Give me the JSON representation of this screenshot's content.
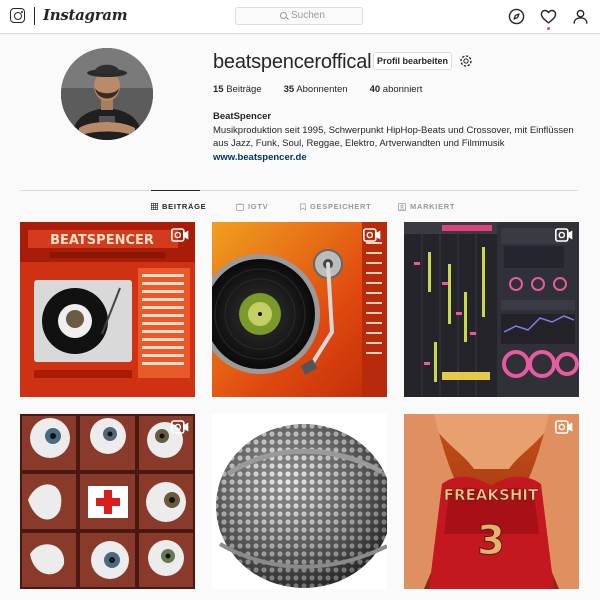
{
  "header": {
    "logo_text": "Instagram",
    "search_placeholder": "Suchen",
    "icons": [
      "instagram-glyph-icon",
      "search-icon",
      "compass-icon",
      "heart-icon",
      "person-icon"
    ],
    "notification_color": "#ed4956"
  },
  "profile": {
    "username": "beatspenceroffical",
    "edit_button": "Profil bearbeiten",
    "stats": {
      "posts_count": "15",
      "posts_label": "Beiträge",
      "followers_count": "35",
      "followers_label": "Abonnenten",
      "following_count": "40",
      "following_label": "abonniert"
    },
    "full_name": "BeatSpencer",
    "bio": "Musikproduktion seit 1995, Schwerpunkt HipHop-Beats und Crossover, mit Einflüssen aus Jazz, Funk, Soul, Reggae, Elektro, Artverwandten und Filmmusik",
    "website": "www.beatspencer.de"
  },
  "tabs": [
    {
      "label": "BEITRÄGE",
      "icon": "grid-icon",
      "active": true
    },
    {
      "label": "IGTV",
      "icon": "igtv-icon",
      "active": false
    },
    {
      "label": "GESPEICHERT",
      "icon": "bookmark-icon",
      "active": false
    },
    {
      "label": "MARKIERT",
      "icon": "tag-icon",
      "active": false
    }
  ],
  "posts": [
    {
      "subject": "beatspencer website with turntable",
      "text": "BEATSPENCER",
      "type": "video"
    },
    {
      "subject": "turntable close-up",
      "type": "video"
    },
    {
      "subject": "music software screenshot",
      "type": "video"
    },
    {
      "subject": "glass eyes in wooden box",
      "type": "video"
    },
    {
      "subject": "microphone grille close-up",
      "type": "video"
    },
    {
      "subject": "freaksht 3 cover",
      "text": "FREAKSHIT",
      "number": "3",
      "type": "video"
    }
  ],
  "colors": {
    "link": "#003569",
    "border": "#dbdbdb",
    "text": "#262626",
    "muted": "#999999"
  }
}
